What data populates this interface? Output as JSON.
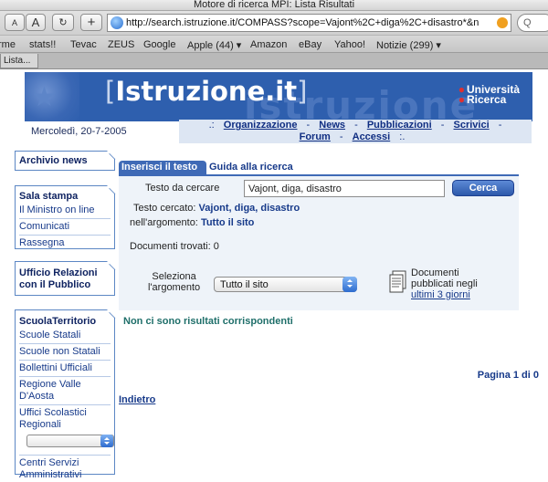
{
  "window": {
    "title": "Motore di ricerca MPI: Lista Risultati"
  },
  "toolbar": {
    "text_small_label": "A",
    "text_large_label": "A",
    "reload_icon": "reload-icon",
    "add_icon": "plus-icon",
    "url": "http://search.istruzione.it/COMPASS?scope=Vajont%2C+diga%2C+disastro*&n",
    "search_placeholder": "Q"
  },
  "bookmarks": [
    "rme",
    "stats!!",
    "Tevac",
    "ZEUS",
    "Google",
    "Apple (44) ▾",
    "Amazon",
    "eBay",
    "Yahoo!",
    "Notizie (299) ▾"
  ],
  "tabs": [
    "Lista..."
  ],
  "header": {
    "logo_bracket_open": "[",
    "logo_text": "Istruzione.it",
    "logo_bracket_close": "]",
    "logo_ghost": "istruzione",
    "universita": "Università",
    "ricerca": "Ricerca",
    "date": "Mercoledì, 20-7-2005"
  },
  "topnav": {
    "prefix": ".:",
    "items": [
      "Organizzazione",
      "News",
      "Pubblicazioni",
      "Scrivici",
      "Forum",
      "Accessi"
    ],
    "suffix": ":."
  },
  "sidebar": {
    "archivio": "Archivio news",
    "sala_stampa": {
      "title": "Sala stampa",
      "items": [
        "Il Ministro on line",
        "Comunicati",
        "Rassegna"
      ]
    },
    "urp": "Ufficio Relazioni con il Pubblico",
    "territorio": {
      "title": "ScuolaTerritorio",
      "items": [
        "Scuole Statali",
        "Scuole non Statali",
        "Bollettini Ufficiali",
        "Regione Valle D'Aosta",
        "Uffici Scolastici Regionali"
      ],
      "after_select": "Centri Servizi Amministrativi"
    }
  },
  "search": {
    "tab_active": "Inserisci il testo",
    "tab_inactive": "Guida alla ricerca",
    "field_label": "Testo da cercare",
    "field_value": "Vajont, diga, disastro",
    "button": "Cerca",
    "searched_label": "Testo cercato:",
    "searched_value": "Vajont, diga, disastro",
    "scope_label": "nell'argomento:",
    "scope_value": "Tutto il sito",
    "found_label": "Documenti trovati: 0",
    "select_label_1": "Seleziona",
    "select_label_2": "l'argomento",
    "select_value": "Tutto il sito",
    "docs_line1": "Documenti",
    "docs_line2": "pubblicati negli",
    "docs_link": "ultimi 3 giorni"
  },
  "results": {
    "none": "Non ci sono risultati corrispondenti",
    "page": "Pagina 1 di 0",
    "back": "Indietro"
  },
  "colors": {
    "brand_blue": "#2e5fae",
    "link_blue": "#173a8a",
    "panel_bg": "#eef3f9"
  }
}
